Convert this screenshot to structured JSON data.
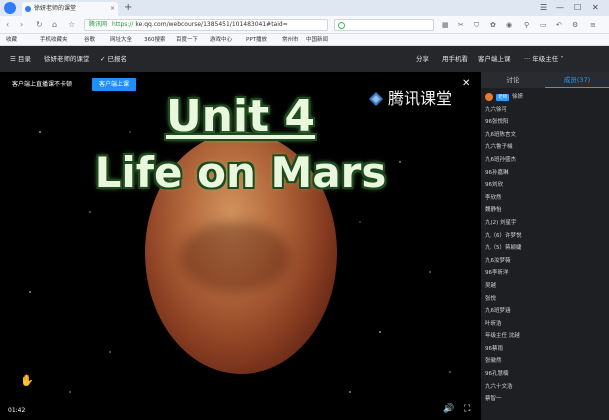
{
  "browser": {
    "tab_title": "徐妍老师的课堂",
    "url_site": "腾讯网",
    "url_scheme": "https://",
    "url_path": "ke.qq.com/webcourse/1385451/101483041#taid=",
    "bookmarks": [
      "收藏",
      "手机收藏夹",
      "谷歌",
      "网址大全",
      "360搜索",
      "百度一下",
      "游戏中心",
      "PPT播放",
      "常州市",
      "中国新闻"
    ]
  },
  "course_bar": {
    "menu_label": "目录",
    "course_name": "徐妍老师的课堂",
    "enrolled_label": "已报名",
    "share_label": "分享",
    "mobile_label": "用手机看",
    "client_label": "客户端上课",
    "user_label": "年级主任"
  },
  "video": {
    "notice_text": "客户端上直播课不卡顿",
    "notice_button": "客户端上课",
    "title_line1": "Unit 4",
    "title_line2": "Life on Mars",
    "watermark_text": "腾讯课堂",
    "current_time": "01:42"
  },
  "sidebar": {
    "tab_discuss": "讨论",
    "tab_members": "成员(37)",
    "teacher_badge": "老师",
    "teacher_name": "徐妍",
    "members": [
      "九六徐可",
      "96张悦阳",
      "九6班陈言文",
      "九六鲁子械",
      "九6班孙盛杰",
      "96孙嘉琳",
      "96刘欣",
      "李欣然",
      "魏静怡",
      "九(2) 刘星宇",
      "九（6）许梦悦",
      "九（5）蒋颖婕",
      "九6汝梦薇",
      "96李昕洋",
      "吴越",
      "张悦",
      "九6班梦涵",
      "叶昕浩",
      "年级主任 沈越",
      "96蔡雨",
      "张徽然",
      "96孔慧楠",
      "九六十文浩",
      "蔡智一"
    ]
  },
  "colors": {
    "accent": "#2b9bff",
    "moon": "#b56a3d",
    "title_text": "#e9f7dc"
  }
}
